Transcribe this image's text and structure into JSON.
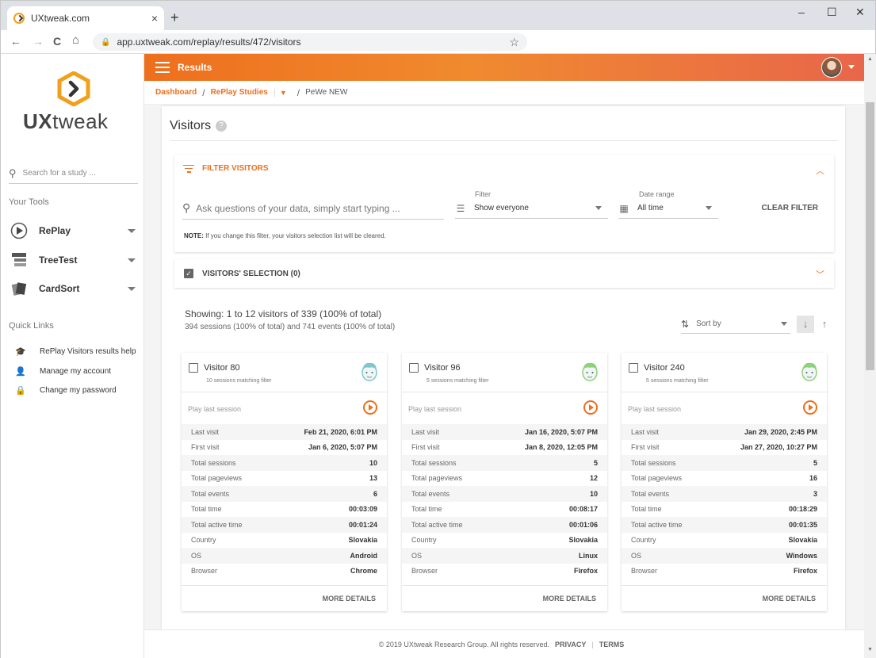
{
  "browser": {
    "tab_title": "UXtweak.com",
    "tab_close": "×",
    "new_tab": "+",
    "url": "app.uxtweak.com/replay/results/472/visitors",
    "controls": {
      "minimize": "–",
      "maximize": "☐",
      "close": "✕"
    },
    "nav": {
      "back": "←",
      "forward": "→",
      "reload": "C",
      "home": "⌂"
    }
  },
  "brand": {
    "logo_part1": "UX",
    "logo_part2": "tweak",
    "accent": "#ee6f1d"
  },
  "sidebar": {
    "search_placeholder": "Search for a study ...",
    "tools_heading": "Your Tools",
    "tools": [
      {
        "label": "RePlay",
        "icon": "replay-icon"
      },
      {
        "label": "TreeTest",
        "icon": "treetest-icon"
      },
      {
        "label": "CardSort",
        "icon": "cardsort-icon"
      }
    ],
    "quick_links_heading": "Quick Links",
    "quick_links": [
      {
        "label": "RePlay Visitors results help",
        "icon": "graduation-cap-icon",
        "glyph": "🎓"
      },
      {
        "label": "Manage my account",
        "icon": "user-circle-icon",
        "glyph": "👤"
      },
      {
        "label": "Change my password",
        "icon": "lock-icon",
        "glyph": "🔒"
      }
    ]
  },
  "header": {
    "title": "Results"
  },
  "breadcrumb": {
    "items": [
      "Dashboard",
      "RePlay Studies"
    ],
    "current": "PeWe NEW",
    "separator": "/"
  },
  "page": {
    "title": "Visitors",
    "help": "?"
  },
  "filter": {
    "heading": "FILTER VISITORS",
    "ask_placeholder": "Ask questions of your data, simply start typing ...",
    "filter_label": "Filter",
    "filter_value": "Show everyone",
    "date_label": "Date range",
    "date_value": "All time",
    "clear_label": "CLEAR FILTER",
    "note_bold": "NOTE:",
    "note_text": " If you change this filter, your visitors selection list will be cleared."
  },
  "selection": {
    "title": "VISITORS' SELECTION (0)"
  },
  "results": {
    "showing": "Showing: 1 to 12 visitors of 339 (100% of total)",
    "summary": "394 sessions (100% of total) and 741 events (100% of total)",
    "sort_label": "Sort by"
  },
  "card_labels": {
    "play": "Play last session",
    "more": "MORE DETAILS",
    "keys": [
      "Last visit",
      "First visit",
      "Total sessions",
      "Total pageviews",
      "Total events",
      "Total time",
      "Total active time",
      "Country",
      "OS",
      "Browser"
    ]
  },
  "visitors": [
    {
      "name": "Visitor 80",
      "sessions": "10 sessions matching filter",
      "face_color": "#7fc6cf",
      "values": [
        "Feb 21, 2020, 6:01 PM",
        "Jan 6, 2020, 5:07 PM",
        "10",
        "13",
        "6",
        "00:03:09",
        "00:01:24",
        "Slovakia",
        "Android",
        "Chrome"
      ]
    },
    {
      "name": "Visitor 96",
      "sessions": "5 sessions matching filter",
      "face_color": "#8fd07a",
      "values": [
        "Jan 16, 2020, 5:07 PM",
        "Jan 8, 2020, 12:05 PM",
        "5",
        "12",
        "10",
        "00:08:17",
        "00:01:06",
        "Slovakia",
        "Linux",
        "Firefox"
      ]
    },
    {
      "name": "Visitor 240",
      "sessions": "5 sessions matching filter",
      "face_color": "#8fd07a",
      "values": [
        "Jan 29, 2020, 2:45 PM",
        "Jan 27, 2020, 10:27 PM",
        "5",
        "16",
        "3",
        "00:18:29",
        "00:01:35",
        "Slovakia",
        "Windows",
        "Firefox"
      ]
    }
  ],
  "footer": {
    "copyright": "© 2019 UXtweak Research Group. All rights reserved.",
    "privacy": "PRIVACY",
    "divider": "|",
    "terms": "TERMS"
  }
}
